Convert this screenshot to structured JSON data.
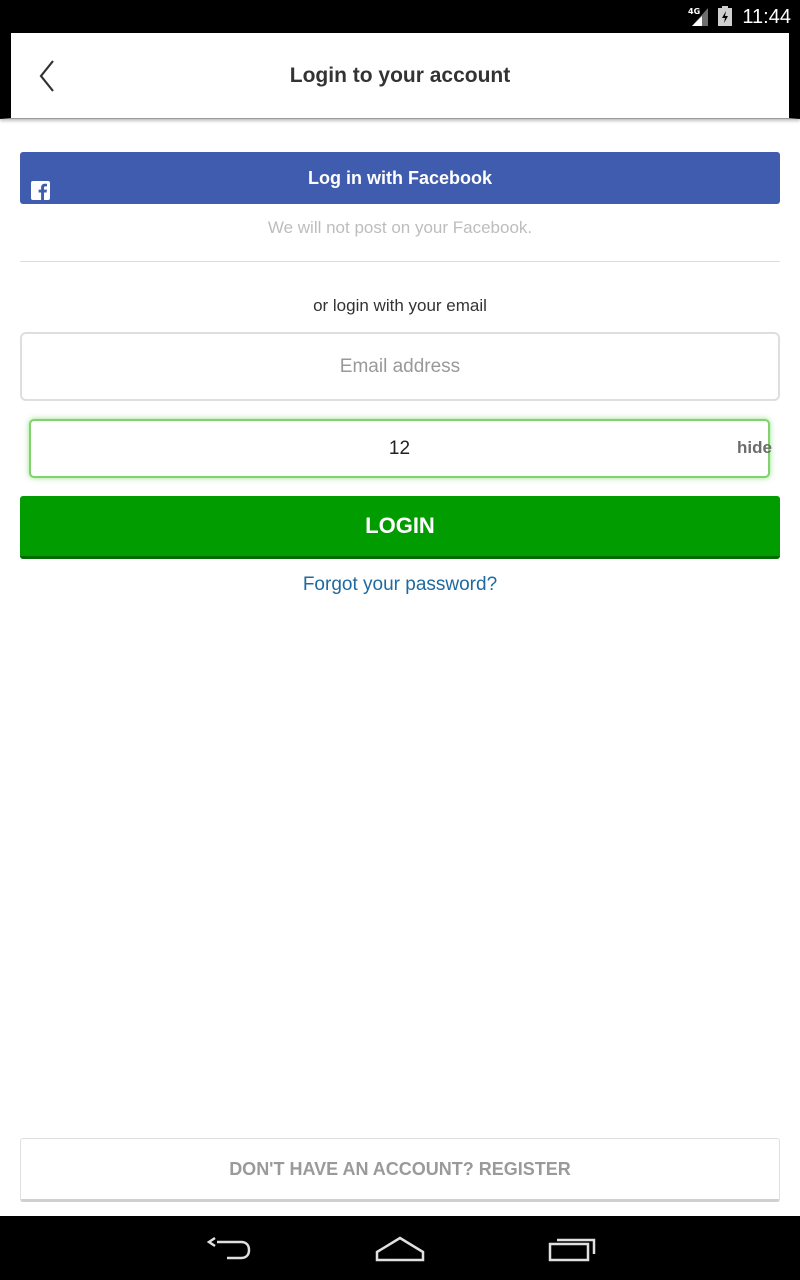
{
  "status_bar": {
    "time": "11:44",
    "network": "4G"
  },
  "header": {
    "title": "Login to your account"
  },
  "facebook": {
    "button_label": "Log in with Facebook",
    "note": "We will not post on your Facebook.",
    "color": "#405cae"
  },
  "email_section": {
    "or_text": "or login with your email"
  },
  "email_field": {
    "placeholder": "Email address",
    "value": ""
  },
  "password_field": {
    "value": "12",
    "toggle_label": "hide"
  },
  "login_button": {
    "label": "LOGIN",
    "color": "#009c00"
  },
  "forgot_link": {
    "label": "Forgot your password?"
  },
  "register_button": {
    "label": "DON'T HAVE AN ACCOUNT? REGISTER"
  },
  "icons": {
    "back": "chevron-left-icon",
    "facebook": "facebook-icon",
    "signal": "signal-icon",
    "battery": "battery-icon",
    "nav_back": "back-icon",
    "nav_home": "home-icon",
    "nav_recents": "recents-icon"
  }
}
